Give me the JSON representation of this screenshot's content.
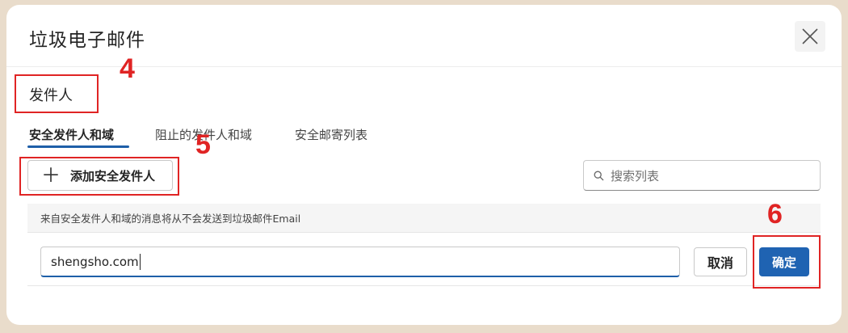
{
  "dialog": {
    "title": "垃圾电子邮件",
    "section_label": "发件人"
  },
  "tabs": [
    {
      "label": "安全发件人和域",
      "active": true
    },
    {
      "label": "阻止的发件人和域",
      "active": false
    },
    {
      "label": "安全邮寄列表",
      "active": false
    }
  ],
  "toolbar": {
    "add_label": "添加安全发件人",
    "search_placeholder": "搜索列表"
  },
  "info_text": "来自安全发件人和域的消息将从不会发送到垃圾邮件Email",
  "entry": {
    "value": "shengsho.com",
    "cancel_label": "取消",
    "ok_label": "确定"
  },
  "annotations": {
    "step4": "4",
    "step5": "5",
    "step6": "6"
  },
  "colors": {
    "accent": "#1f63b2",
    "annotation": "#e02424",
    "backdrop": "#e9dccb"
  },
  "icons": {
    "close": "close-icon",
    "add": "plus-icon",
    "search": "search-icon"
  }
}
